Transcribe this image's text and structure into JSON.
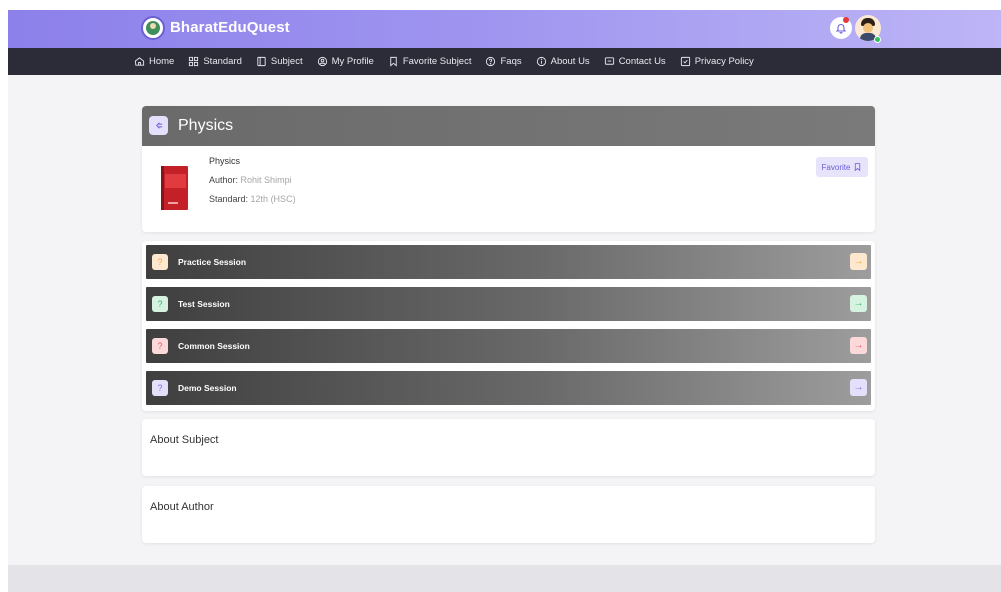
{
  "brand": {
    "name": "BharatEduQuest"
  },
  "nav": {
    "items": [
      {
        "label": "Home",
        "icon": "home-icon"
      },
      {
        "label": "Standard",
        "icon": "grid-icon"
      },
      {
        "label": "Subject",
        "icon": "book-open-icon"
      },
      {
        "label": "My Profile",
        "icon": "user-circle-icon"
      },
      {
        "label": "Favorite Subject",
        "icon": "bookmark-icon"
      },
      {
        "label": "Faqs",
        "icon": "question-circle-icon"
      },
      {
        "label": "About Us",
        "icon": "info-circle-icon"
      },
      {
        "label": "Contact Us",
        "icon": "chat-icon"
      },
      {
        "label": "Privacy Policy",
        "icon": "check-square-icon"
      }
    ]
  },
  "subject": {
    "title": "Physics",
    "name": "Physics",
    "author_label": "Author:",
    "author_value": "Rohit Shimpi",
    "standard_label": "Standard:",
    "standard_value": "12th (HSC)",
    "favorite_label": "Favorite"
  },
  "sessions": [
    {
      "label": "Practice Session",
      "accent": "#f5a43b",
      "tint": "#fde8cf"
    },
    {
      "label": "Test Session",
      "accent": "#2fb86a",
      "tint": "#d6f3e1"
    },
    {
      "label": "Common Session",
      "accent": "#e8585e",
      "tint": "#fbd9da"
    },
    {
      "label": "Demo Session",
      "accent": "#7a6ee0",
      "tint": "#e4e0fb"
    }
  ],
  "about": {
    "subject_title": "About Subject",
    "author_title": "About Author"
  },
  "colors": {
    "brand_gradient_start": "#8c80ea",
    "brand_gradient_end": "#bdb5f6",
    "nav_background": "#2c2c38",
    "accent": "#6a5fd8"
  }
}
